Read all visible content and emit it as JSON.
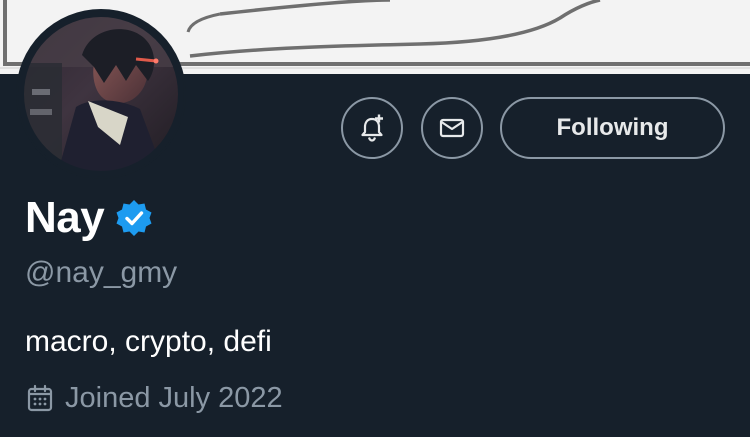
{
  "colors": {
    "page_background": "#16202b",
    "banner_background": "#f3f3f3",
    "text_primary": "#e7e9ea",
    "text_secondary": "#8b98a5",
    "verified_badge": "#1d9bf0",
    "button_border": "#8b98a5"
  },
  "profile": {
    "display_name": "Nay",
    "verified": true,
    "handle": "@nay_gmy",
    "bio": "macro, crypto, defi",
    "joined_text": "Joined July 2022"
  },
  "actions": {
    "notify_icon": "bell-plus-icon",
    "message_icon": "envelope-icon",
    "follow_label": "Following"
  },
  "icons": {
    "verified": "verified-badge-icon",
    "joined": "calendar-icon"
  }
}
